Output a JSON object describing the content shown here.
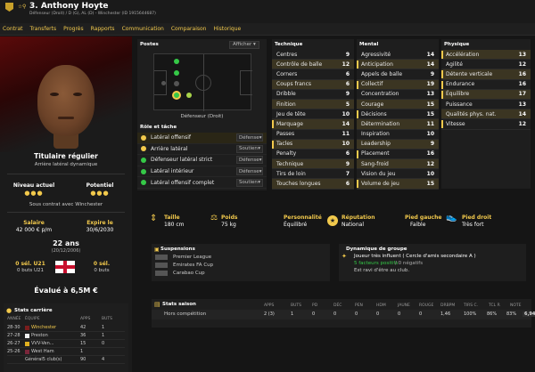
{
  "header": {
    "number_name": "3. Anthony Hoyte",
    "subtitle": "Défenseur (Droit) / D (G), AL (D) - Winchester (ID 1915644687)"
  },
  "nav": [
    "Contrat",
    "Transferts",
    "Progrès",
    "Rapports",
    "Communication",
    "Comparaison",
    "Historique"
  ],
  "profile": {
    "status": "Titulaire régulier",
    "role": "Arrière latéral dynamique",
    "level_now": "Niveau actuel",
    "potential": "Potentiel",
    "contract": "Sous contrat avec Winchester",
    "salary_label": "Salaire",
    "salary": "42 000 € p/m",
    "expires_label": "Expire le",
    "expires": "30/6/2030",
    "age": "22 ans",
    "dob": "(20/12/2006)",
    "u21_sel": "0 sél. U21",
    "u21_goals": "0 buts U21",
    "sel": "0 sél.",
    "goals": "0 buts",
    "valued": "Évalué à 6,5M €"
  },
  "career": {
    "title": "Stats carrière",
    "cols": [
      "ANNÉE",
      "ÉQUIPE",
      "APPS",
      "BUTS"
    ],
    "rows": [
      [
        "28-30",
        "Winchester",
        "42",
        "1"
      ],
      [
        "27-28",
        "Preston",
        "36",
        "1"
      ],
      [
        "26-27",
        "VVV-Ven...",
        "15",
        "0"
      ],
      [
        "25-26",
        "West Ham",
        "1",
        ""
      ],
      [
        "",
        "Général5 club(s)",
        "90",
        "4"
      ]
    ]
  },
  "positions": {
    "title": "Postes",
    "show": "Afficher",
    "pos_label": "Défenseur (Droit)"
  },
  "roles": {
    "title": "Rôle et tâche",
    "items": [
      {
        "name": "Latéral offensif",
        "task": "Défense"
      },
      {
        "name": "Arrière latéral",
        "task": "Soutien"
      },
      {
        "name": "Défenseur latéral strict",
        "task": "Défense"
      },
      {
        "name": "Latéral intérieur",
        "task": "Défense"
      },
      {
        "name": "Latéral offensif complet",
        "task": "Soutien"
      }
    ]
  },
  "technique": {
    "title": "Technique",
    "items": [
      [
        "Centres",
        "9"
      ],
      [
        "Contrôle de balle",
        "12"
      ],
      [
        "Corners",
        "6"
      ],
      [
        "Coups francs",
        "6"
      ],
      [
        "Dribble",
        "9"
      ],
      [
        "Finition",
        "5"
      ],
      [
        "Jeu de tête",
        "10"
      ],
      [
        "Marquage",
        "14"
      ],
      [
        "Passes",
        "11"
      ],
      [
        "Tacles",
        "10"
      ],
      [
        "Penalty",
        "6"
      ],
      [
        "Technique",
        "9"
      ],
      [
        "Tirs de loin",
        "7"
      ],
      [
        "Touches longues",
        "6"
      ]
    ]
  },
  "mental": {
    "title": "Mental",
    "items": [
      [
        "Agressivité",
        "14"
      ],
      [
        "Anticipation",
        "14"
      ],
      [
        "Appels de balle",
        "9"
      ],
      [
        "Collectif",
        "19"
      ],
      [
        "Concentration",
        "13"
      ],
      [
        "Courage",
        "15"
      ],
      [
        "Décisions",
        "15"
      ],
      [
        "Détermination",
        "11"
      ],
      [
        "Inspiration",
        "10"
      ],
      [
        "Leadership",
        "9"
      ],
      [
        "Placement",
        "16"
      ],
      [
        "Sang-froid",
        "12"
      ],
      [
        "Vision du jeu",
        "10"
      ],
      [
        "Volume de jeu",
        "15"
      ]
    ]
  },
  "physique": {
    "title": "Physique",
    "items": [
      [
        "Accélération",
        "13"
      ],
      [
        "Agilité",
        "12"
      ],
      [
        "Détente verticale",
        "16"
      ],
      [
        "Endurance",
        "16"
      ],
      [
        "Équilibre",
        "17"
      ],
      [
        "Puissance",
        "13"
      ],
      [
        "Qualités phys. nat.",
        "14"
      ],
      [
        "Vitesse",
        "12"
      ]
    ]
  },
  "body": {
    "height_label": "Taille",
    "height": "180 cm",
    "weight_label": "Poids",
    "weight": "75 kg",
    "pers_label": "Personnalité",
    "pers": "Équilibré",
    "rep_label": "Réputation",
    "rep": "National",
    "lf_label": "Pied gauche",
    "lf": "Faible",
    "rf_label": "Pied droit",
    "rf": "Très fort"
  },
  "suspensions": {
    "title": "Suspensions",
    "items": [
      "Premier League",
      "Emirates FA Cup",
      "Carabao Cup"
    ]
  },
  "dynamics": {
    "title": "Dynamique de groupe",
    "l1": "Joueur très influent ( Cercle d'amis secondaire A )",
    "l2": "5 facteurs positifs",
    "l3": "/ 0 négatifs",
    "l4": "Est ravi d'être au club."
  },
  "season": {
    "title": "Stats saison",
    "cols": [
      "APPS",
      "BUTS",
      "PD",
      "DÉC",
      "PEN",
      "HDM",
      "JAUNE",
      "ROUGE",
      "DRBPM",
      "TIRS C.",
      "TCL R",
      "NOTE"
    ],
    "row_label": "Hors compétition",
    "row": [
      "2 (3)",
      "1",
      "0",
      "0",
      "0",
      "0",
      "0",
      "0",
      "1,46",
      "100%",
      "86%",
      "83%",
      "6,94"
    ]
  },
  "colors": {
    "accent": "#f2c94c",
    "hilite": "#3b3522"
  }
}
